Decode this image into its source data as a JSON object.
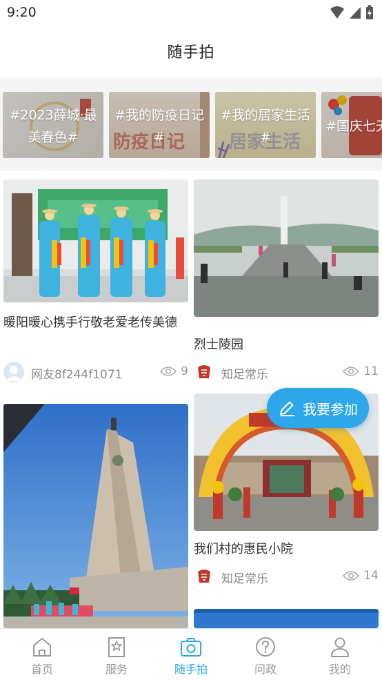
{
  "status": {
    "time": "9:20"
  },
  "header": {
    "title": "随手拍"
  },
  "topics": [
    {
      "label": "#2023薛城·最美春色#",
      "deco": "薛城",
      "color": "#e4e1dc"
    },
    {
      "label": "#我的防疫日记#",
      "deco": "防疫日记",
      "color": "#e9ddd0"
    },
    {
      "label": "#我的居家生活#",
      "deco": "居家生活",
      "color": "#eee7c9"
    },
    {
      "label": "#国庆七天",
      "deco": "国庆七天",
      "color": "#e8dfd6"
    }
  ],
  "posts": [
    {
      "title": "暖阳暖心携手行敬老爱老传美德",
      "author": "网友8f244f1071",
      "views": "9",
      "avatar": "default-user-avatar"
    },
    {
      "title": "烈士陵园",
      "author": "知足常乐",
      "views": "11",
      "avatar": "red-seal-avatar"
    },
    {
      "title": "",
      "author": "",
      "views": "",
      "avatar": ""
    },
    {
      "title": "我们村的惠民小院",
      "author": "知足常乐",
      "views": "14",
      "avatar": "red-seal-avatar"
    }
  ],
  "fab": {
    "label": "我要参加",
    "icon": "edit-pencil-icon"
  },
  "tabs": [
    {
      "label": "首页",
      "icon": "home-icon"
    },
    {
      "label": "服务",
      "icon": "bookmark-star-icon"
    },
    {
      "label": "随手拍",
      "icon": "camera-icon",
      "active": true
    },
    {
      "label": "问政",
      "icon": "question-circle-icon"
    },
    {
      "label": "我的",
      "icon": "user-icon"
    }
  ],
  "colors": {
    "accent": "#2ea6ea",
    "inactive": "#999999"
  }
}
